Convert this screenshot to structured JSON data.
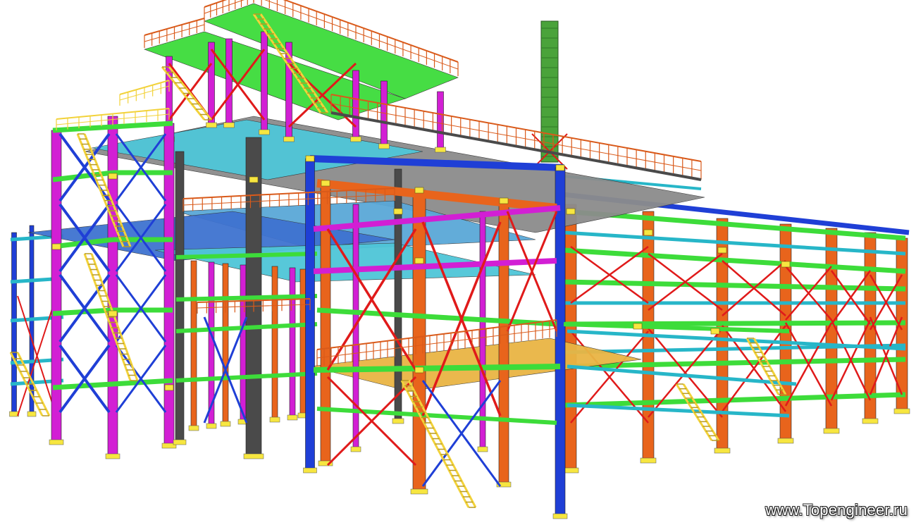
{
  "watermark": "www.Topengineer.ru",
  "colors": {
    "column_orange": "#e8641c",
    "column_magenta": "#d21fd4",
    "column_blue": "#1f3fd6",
    "column_gray": "#4a4a4a",
    "beam_green": "#3ddc3a",
    "beam_cyan": "#27b6c8",
    "brace_red": "#e01a1a",
    "stair_yellow": "#f2d23a",
    "plate_yellow": "#f7e640",
    "slab_gray": "#8c8c8c",
    "slab_cyan": "#4fc6d8",
    "chimney_green": "#4aa33a",
    "railing_orange": "#d95a1a"
  }
}
